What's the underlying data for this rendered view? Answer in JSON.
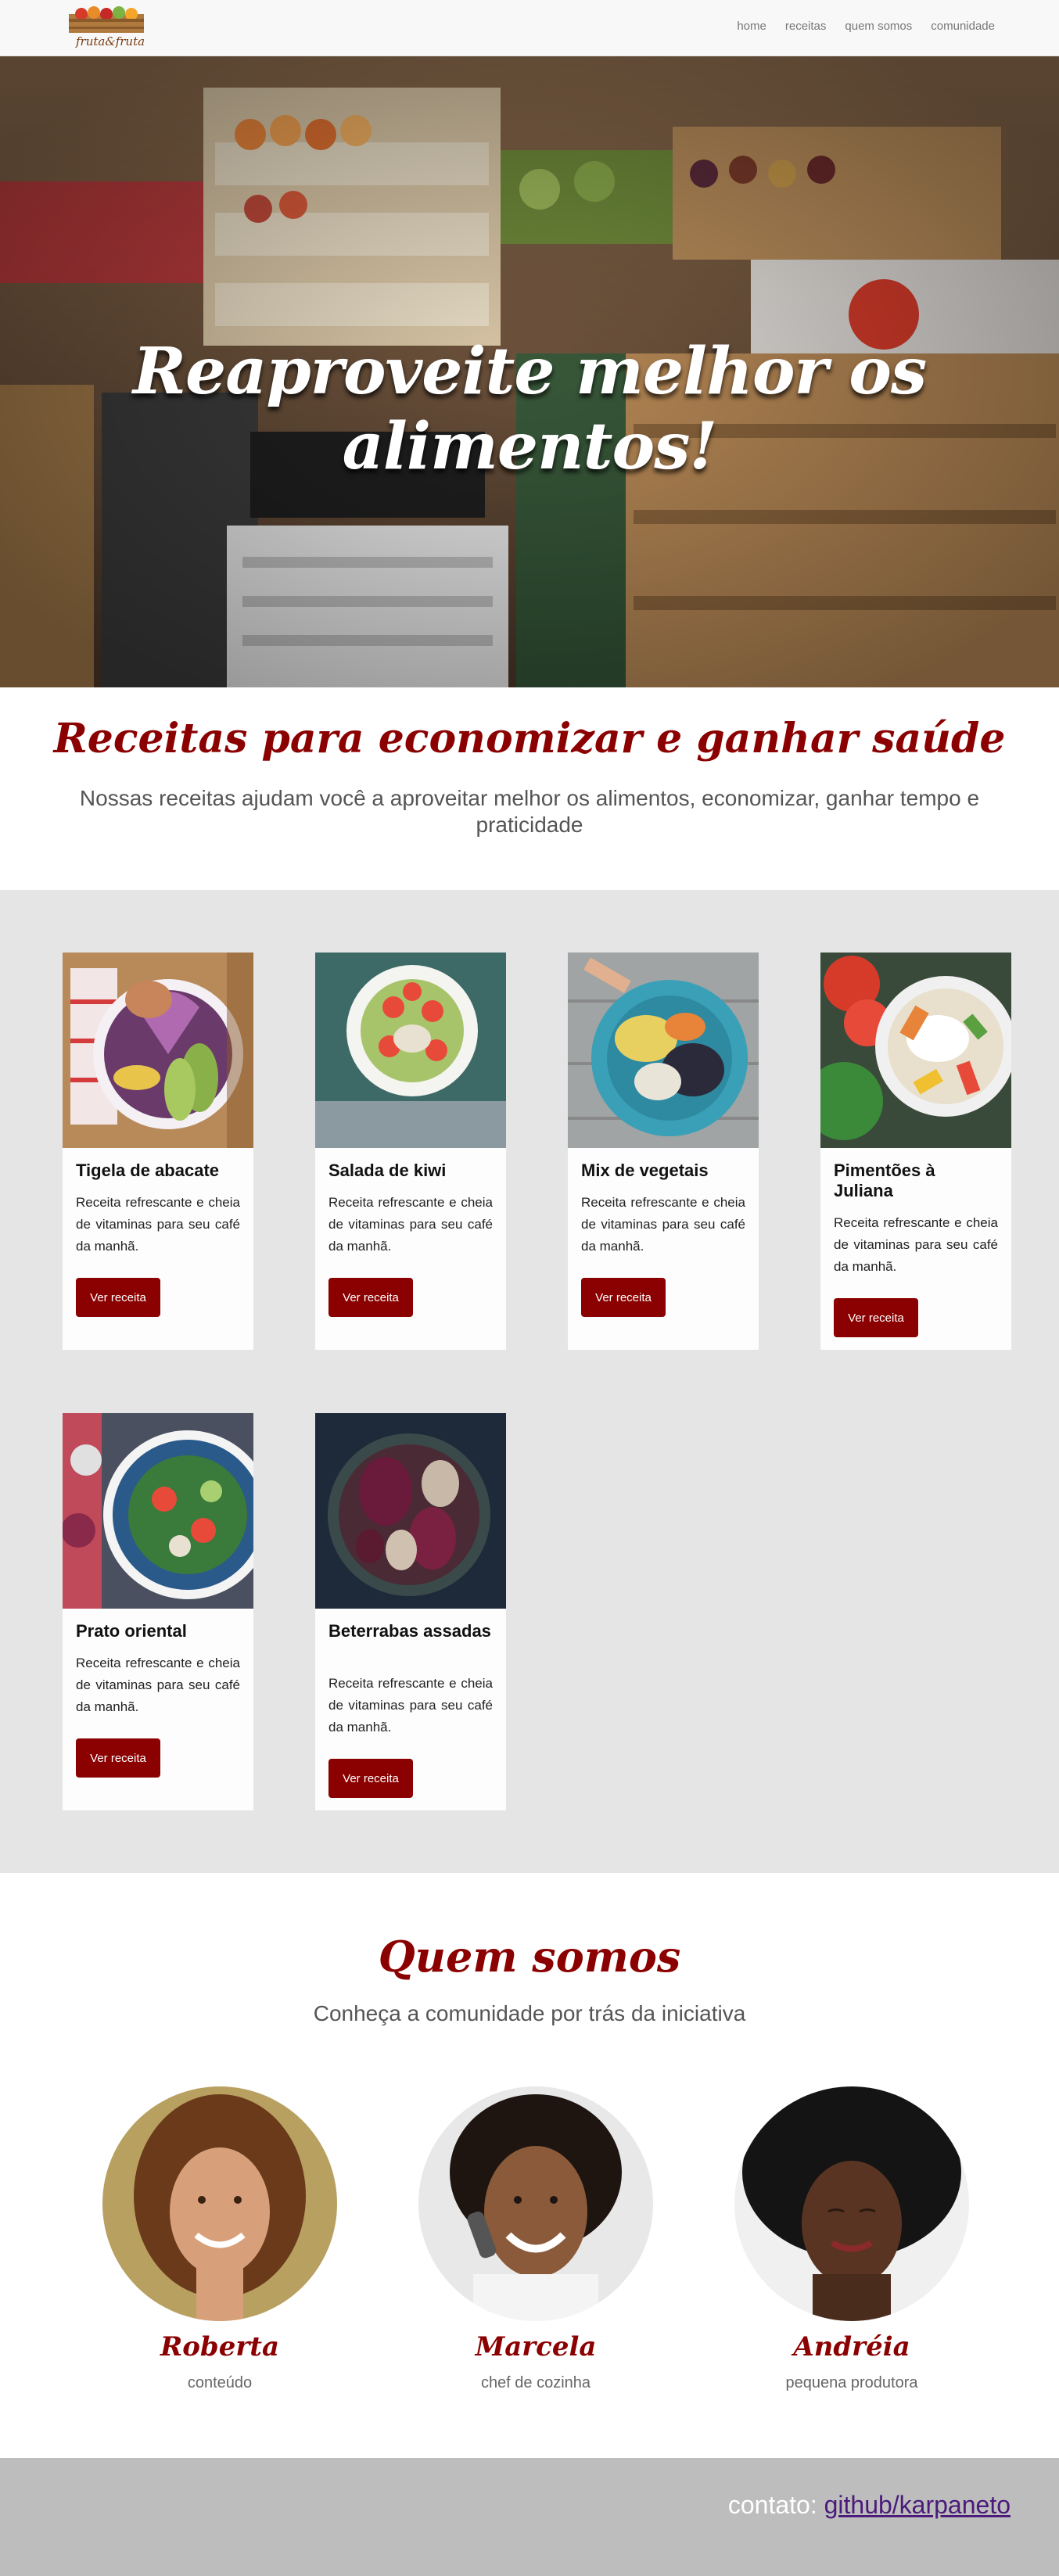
{
  "nav": {
    "logo_text": "fruta&fruta",
    "links": [
      "home",
      "receitas",
      "quem somos",
      "comunidade"
    ]
  },
  "hero": {
    "title": "Reaproveite melhor os alimentos!"
  },
  "intro": {
    "title": "Receitas para economizar e ganhar saúde",
    "subtitle": "Nossas receitas ajudam você a aproveitar melhor os alimentos, economizar, ganhar tempo e praticidade"
  },
  "recipes": [
    {
      "title": "Tigela de abacate",
      "text": "Receita refrescante e cheia de vitaminas para seu café da manhã.",
      "button": "Ver receita"
    },
    {
      "title": "Salada de kiwi",
      "text": "Receita refrescante e cheia de vitaminas para seu café da manhã.",
      "button": "Ver receita"
    },
    {
      "title": "Mix de vegetais",
      "text": "Receita refrescante e cheia de vitaminas para seu café da manhã.",
      "button": "Ver receita"
    },
    {
      "title": "Pimentões à Juliana",
      "text": "Receita refrescante e cheia de vitaminas para seu café da manhã.",
      "button": "Ver receita"
    },
    {
      "title": "Prato oriental",
      "text": "Receita refrescante e cheia de vitaminas para seu café da manhã.",
      "button": "Ver receita"
    },
    {
      "title": "Beterrabas assadas",
      "text": "Receita refrescante e cheia de vitaminas para seu café da manhã.",
      "button": "Ver receita"
    }
  ],
  "about": {
    "title": "Quem somos",
    "subtitle": "Conheça a comunidade por trás da iniciativa",
    "members": [
      {
        "name": "Roberta",
        "role": "conteúdo"
      },
      {
        "name": "Marcela",
        "role": "chef de cozinha"
      },
      {
        "name": "Andréia",
        "role": "pequena produtora"
      }
    ]
  },
  "footer": {
    "label": "contato:",
    "link_text": "github/karpaneto"
  },
  "colors": {
    "brand": "#8b0000",
    "footer_bg": "#bdbdbd",
    "section_bg": "#e5e5e5"
  }
}
